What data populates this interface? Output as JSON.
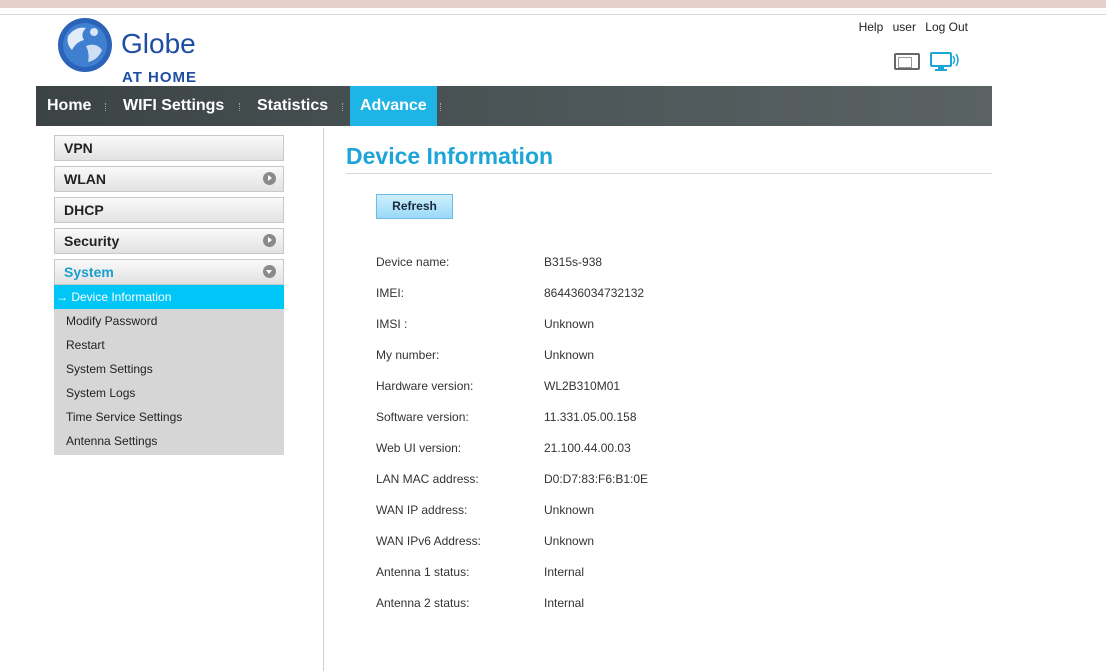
{
  "brand": {
    "name": "Globe",
    "sub": "AT HOME"
  },
  "toplinks": {
    "help": "Help",
    "user": "user",
    "logout": "Log Out"
  },
  "nav": {
    "items": [
      {
        "label": "Home"
      },
      {
        "label": "WIFI Settings"
      },
      {
        "label": "Statistics"
      },
      {
        "label": "Advance"
      }
    ],
    "active": "Advance"
  },
  "sidebar": {
    "items": [
      {
        "label": "VPN"
      },
      {
        "label": "WLAN"
      },
      {
        "label": "DHCP"
      },
      {
        "label": "Security"
      },
      {
        "label": "System"
      }
    ],
    "submenu": [
      {
        "label": "→ Device Information"
      },
      {
        "label": "Modify Password"
      },
      {
        "label": "Restart"
      },
      {
        "label": "System Settings"
      },
      {
        "label": "System Logs"
      },
      {
        "label": "Time Service Settings"
      },
      {
        "label": "Antenna Settings"
      }
    ]
  },
  "main": {
    "title": "Device Information",
    "refresh_label": "Refresh",
    "rows": [
      {
        "label": "Device name:",
        "value": "B315s-938"
      },
      {
        "label": "IMEI:",
        "value": "864436034732132"
      },
      {
        "label": "IMSI :",
        "value": "Unknown"
      },
      {
        "label": "My number:",
        "value": "Unknown"
      },
      {
        "label": "Hardware version:",
        "value": "WL2B310M01"
      },
      {
        "label": "Software version:",
        "value": "11.331.05.00.158"
      },
      {
        "label": "Web UI version:",
        "value": "21.100.44.00.03"
      },
      {
        "label": "LAN MAC address:",
        "value": "D0:D7:83:F6:B1:0E"
      },
      {
        "label": "WAN IP address:",
        "value": "Unknown"
      },
      {
        "label": "WAN IPv6 Address:",
        "value": "Unknown"
      },
      {
        "label": "Antenna 1 status:",
        "value": "Internal"
      },
      {
        "label": "Antenna 2 status:",
        "value": "Internal"
      }
    ]
  },
  "colors": {
    "accent": "#1ea5d8",
    "nav_active": "#1eb4e6",
    "submenu_active": "#00c6f7",
    "brand": "#1e4ea1"
  },
  "icons": {
    "logo": "globe-logo-icon",
    "sim": "sim-card-icon",
    "network": "network-monitor-icon"
  }
}
